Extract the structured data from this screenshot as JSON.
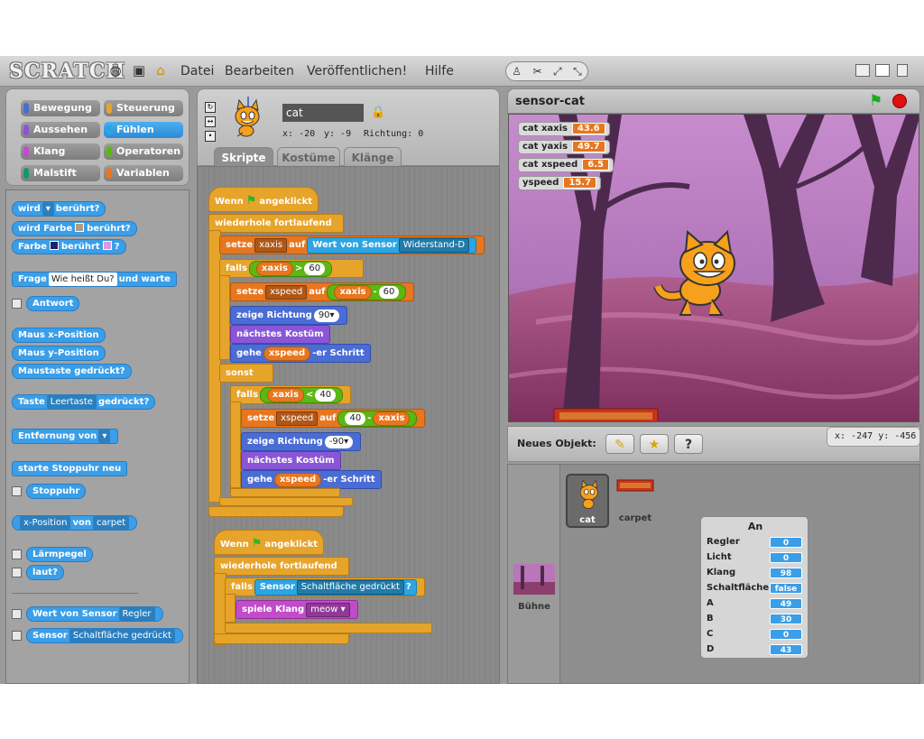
{
  "app": {
    "logo": "SCRATCH"
  },
  "menu": {
    "items": [
      "Datei",
      "Bearbeiten",
      "Veröffentlichen!",
      "Hilfe"
    ]
  },
  "toolbar": {
    "tools": [
      "stamp-icon",
      "scissors-icon",
      "grow-icon",
      "shrink-icon"
    ]
  },
  "categories": {
    "items": [
      {
        "label": "Bewegung",
        "color": "#4a6cd4"
      },
      {
        "label": "Steuerung",
        "color": "#e7a42a"
      },
      {
        "label": "Aussehen",
        "color": "#8a55d7"
      },
      {
        "label": "Fühlen",
        "color": "#2ca5e2"
      },
      {
        "label": "Klang",
        "color": "#c04cc8"
      },
      {
        "label": "Operatoren",
        "color": "#5cb712"
      },
      {
        "label": "Malstift",
        "color": "#0e9a6c"
      },
      {
        "label": "Variablen",
        "color": "#e8761f"
      }
    ],
    "active": "Fühlen"
  },
  "palette": {
    "touching_label": "wird",
    "touching_suffix": "berührt?",
    "color_touch_a": "wird Farbe",
    "color_touch_b": "berührt?",
    "color_touch_c_a": "Farbe",
    "color_touch_c_b": "berührt",
    "color_touch_c_c": "?",
    "ask_a": "Frage",
    "ask_value": "Wie heißt Du?",
    "ask_b": "und warte",
    "answer": "Antwort",
    "mouse_x": "Maus x-Position",
    "mouse_y": "Maus y-Position",
    "mouse_down": "Maustaste gedrückt?",
    "key_a": "Taste",
    "key_value": "Leertaste",
    "key_b": "gedrückt?",
    "distance": "Entfernung von",
    "timer_reset": "starte Stoppuhr neu",
    "timer": "Stoppuhr",
    "of_attr": "x-Position",
    "of_word": "von",
    "of_obj": "carpet",
    "loudness": "Lärmpegel",
    "loud": "laut?",
    "sensor_value_a": "Wert von Sensor",
    "sensor_value_b": "Regler",
    "sensor_a": "Sensor",
    "sensor_b": "Schaltfläche gedrückt"
  },
  "sprite": {
    "name": "cat",
    "x": "x: -20",
    "y": "y: -9",
    "direction": "Richtung: 0"
  },
  "tabs": [
    "Skripte",
    "Kostüme",
    "Klänge"
  ],
  "script1": {
    "hat_a": "Wenn",
    "hat_b": "angeklickt",
    "forever": "wiederhole fortlaufend",
    "set": "setze",
    "set_var": "xaxis",
    "to": "auf",
    "sensor_val": "Wert von Sensor",
    "sensor_sel": "Widerstand-D",
    "if": "falls",
    "cond1_var": "xaxis",
    "cond1_op": ">",
    "cond1_val": "60",
    "set2_var": "xspeed",
    "set2_a": "xaxis",
    "set2_op": "-",
    "set2_b": "60",
    "point": "zeige Richtung",
    "point_val": "90",
    "next_costume": "nächstes Kostüm",
    "move_a": "gehe",
    "move_var": "xspeed",
    "move_b": "-er Schritt",
    "else": "sonst",
    "cond2_var": "xaxis",
    "cond2_op": "<",
    "cond2_val": "40",
    "set3_var": "xspeed",
    "set3_a": "40",
    "set3_op": "-",
    "set3_b": "xaxis",
    "point2_val": "-90"
  },
  "script2": {
    "sensor": "Sensor",
    "sensor_sel": "Schaltfläche gedrückt",
    "q": "?",
    "play": "spiele Klang",
    "sound": "meow"
  },
  "stage": {
    "title": "sensor-cat",
    "monitors": [
      {
        "label": "cat xaxis",
        "value": "43.6"
      },
      {
        "label": "cat yaxis",
        "value": "49.7"
      },
      {
        "label": "cat xspeed",
        "value": "6.5"
      },
      {
        "label": "yspeed",
        "value": "15.7"
      }
    ]
  },
  "sprites_panel": {
    "new_object": "Neues Objekt:",
    "mouse_x": "x: -247",
    "mouse_y": "y: -456",
    "items": [
      "cat",
      "carpet"
    ],
    "stage_label": "Bühne"
  },
  "board": {
    "title": "An",
    "rows": [
      {
        "label": "Regler",
        "value": "0"
      },
      {
        "label": "Licht",
        "value": "0"
      },
      {
        "label": "Klang",
        "value": "98"
      },
      {
        "label": "Schaltfläche",
        "value": "false"
      },
      {
        "label": "A",
        "value": "49"
      },
      {
        "label": "B",
        "value": "30"
      },
      {
        "label": "C",
        "value": "0"
      },
      {
        "label": "D",
        "value": "43"
      }
    ]
  },
  "colors": {
    "control": "#e7a42a",
    "variables": "#e8761f",
    "motion": "#4a6cd4",
    "looks": "#8a55d7",
    "sound": "#c04cc8",
    "sensing": "#2ca5e2",
    "operators": "#5cb712"
  }
}
